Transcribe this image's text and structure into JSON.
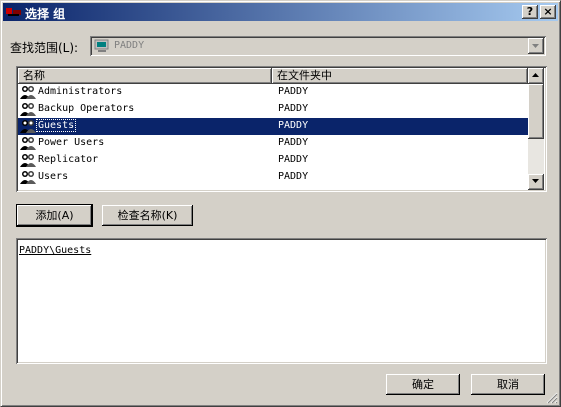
{
  "window": {
    "title": "选择 组",
    "help_label": "?",
    "close_label": "×"
  },
  "lookin": {
    "label": "查找范围(L):",
    "value": "PADDY",
    "icon": "computer-icon"
  },
  "list": {
    "columns": [
      "名称",
      "在文件夹中"
    ],
    "rows": [
      {
        "name": "Administrators",
        "folder": "PADDY",
        "icon": "group-icon",
        "selected": false
      },
      {
        "name": "Backup Operators",
        "folder": "PADDY",
        "icon": "group-icon",
        "selected": false
      },
      {
        "name": "Guests",
        "folder": "PADDY",
        "icon": "group-icon",
        "selected": true
      },
      {
        "name": "Power Users",
        "folder": "PADDY",
        "icon": "group-icon",
        "selected": false
      },
      {
        "name": "Replicator",
        "folder": "PADDY",
        "icon": "group-icon",
        "selected": false
      },
      {
        "name": "Users",
        "folder": "PADDY",
        "icon": "group-icon",
        "selected": false
      }
    ]
  },
  "buttons": {
    "add": "添加(A)",
    "check_names": "检查名称(K)",
    "ok": "确定",
    "cancel": "取消"
  },
  "selected_items": {
    "text": "PADDY\\Guests"
  },
  "colors": {
    "selection": "#0a246a",
    "face": "#d4d0c8"
  }
}
